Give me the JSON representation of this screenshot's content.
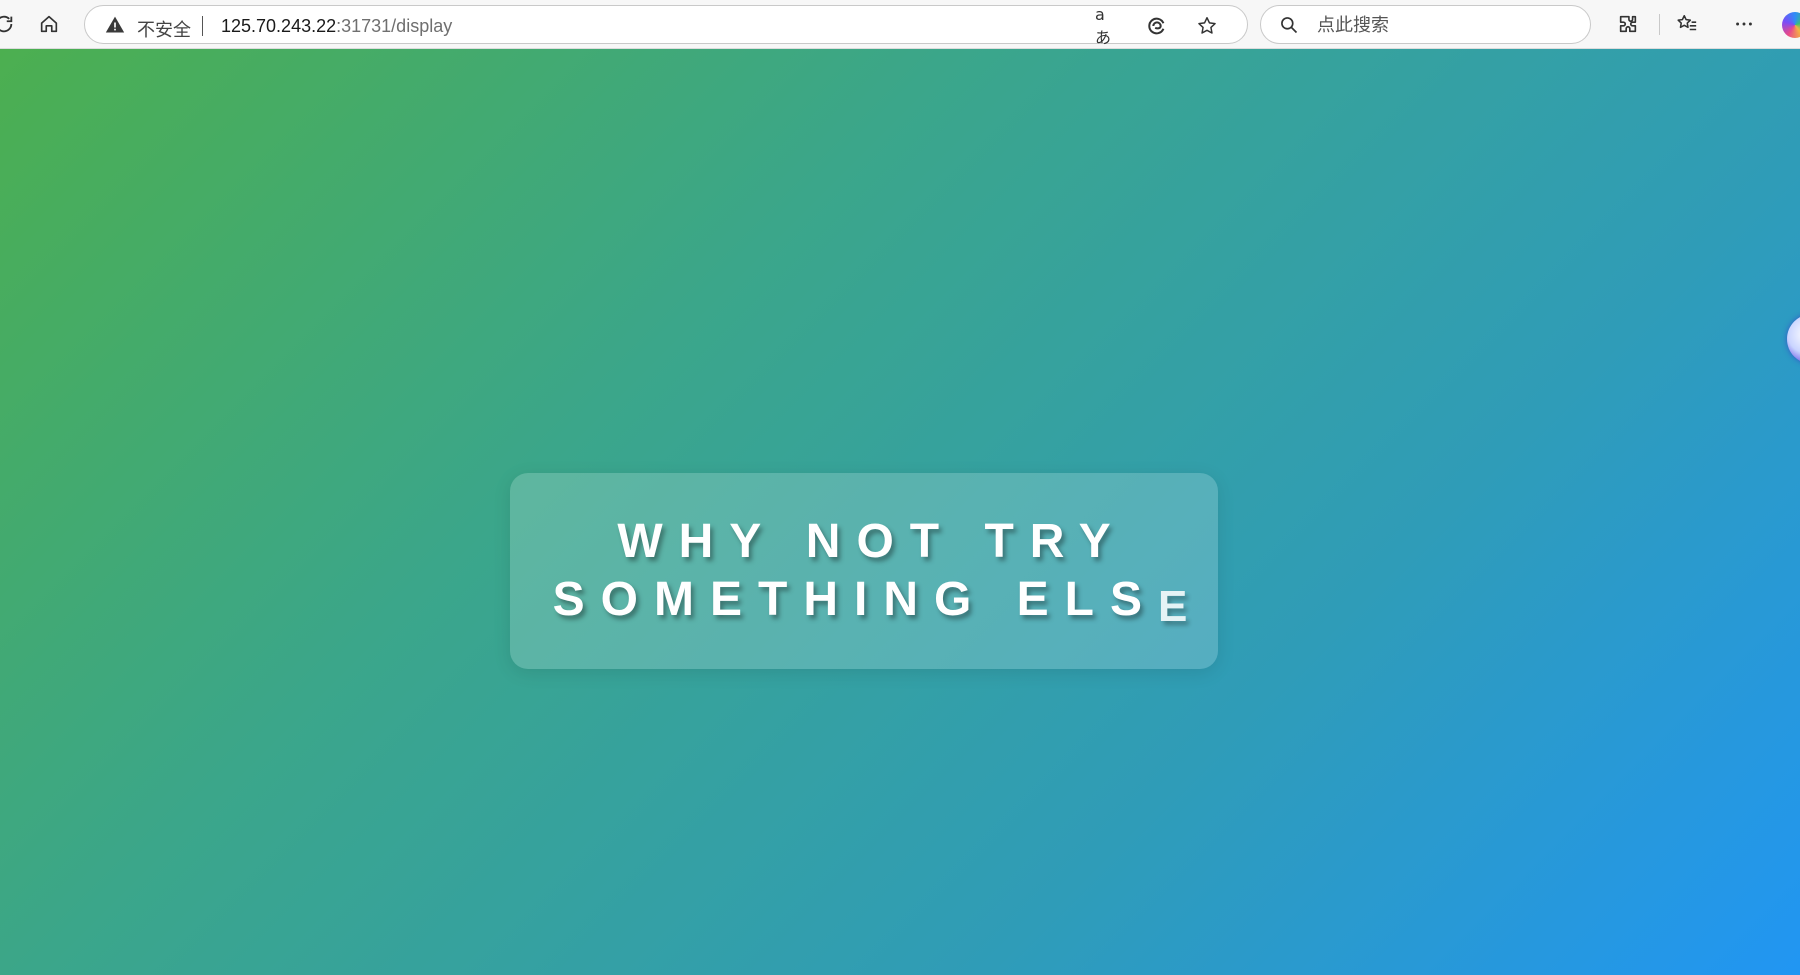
{
  "browser": {
    "address_bar": {
      "security_label": "不安全",
      "url_host": "125.70.243.22",
      "url_path": ":31731/display",
      "translate_glyph": "aあ"
    },
    "search": {
      "placeholder": "点此搜索"
    },
    "icons": [
      "reload-icon",
      "home-icon",
      "warning-icon",
      "translate-icon",
      "edge-refresh-icon",
      "star-icon",
      "search-icon",
      "extensions-icon",
      "favorites-icon",
      "more-icon",
      "copilot-icon"
    ]
  },
  "page": {
    "message_line1": "WHY NOT TRY",
    "message_line2_main": "SOMETHING ELS",
    "message_line2_last": "E",
    "background_colors": [
      "#4caf50",
      "#2196f3"
    ]
  }
}
